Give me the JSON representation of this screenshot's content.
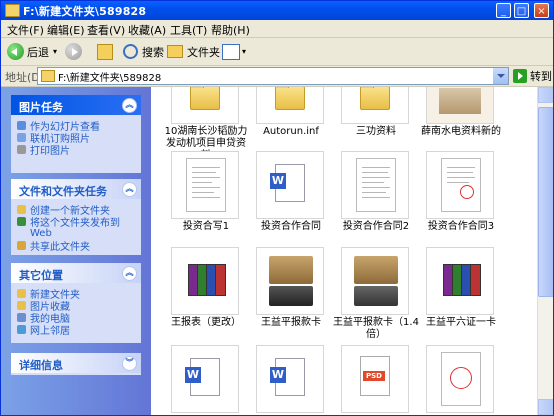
{
  "window": {
    "title": "F:\\新建文件夹\\589828",
    "buttons": {
      "minimize": "_",
      "maximize": "□",
      "close": "×"
    }
  },
  "menu": [
    "文件(F)",
    "编辑(E)",
    "查看(V)",
    "收藏(A)",
    "工具(T)",
    "帮助(H)"
  ],
  "toolbar": {
    "back": "后退",
    "search": "搜索",
    "folders": "文件夹"
  },
  "address": {
    "label": "地址(D)",
    "value": "F:\\新建文件夹\\589828",
    "go": "转到"
  },
  "tasks": {
    "picture_tasks": {
      "title": "图片任务",
      "items": [
        "作为幻灯片查看",
        "联机订购照片",
        "打印图片"
      ]
    },
    "file_tasks": {
      "title": "文件和文件夹任务",
      "items": [
        "创建一个新文件夹",
        "将这个文件夹发布到",
        "Web",
        "共享此文件夹"
      ]
    },
    "other_places": {
      "title": "其它位置",
      "items": [
        "新建文件夹",
        "图片收藏",
        "我的电脑",
        "网上邻居"
      ]
    },
    "details": {
      "title": "详细信息"
    }
  },
  "files": [
    {
      "name": "10湖南长沙韬励力发动机项目申贷资料",
      "type": "folder"
    },
    {
      "name": "Autorun.inf",
      "type": "folder"
    },
    {
      "name": "三功资料",
      "type": "folder"
    },
    {
      "name": "薛南水电资料新的",
      "type": "photo"
    },
    {
      "name": "投资合写1",
      "type": "document"
    },
    {
      "name": "投资合作合同",
      "type": "word"
    },
    {
      "name": "投资合作合同2",
      "type": "document"
    },
    {
      "name": "投资合作合同3",
      "type": "document-stamp"
    },
    {
      "name": "王报表（更改）",
      "type": "archive"
    },
    {
      "name": "王益平报款卡",
      "type": "card"
    },
    {
      "name": "王益平报款卡（1.4倍）",
      "type": "card"
    },
    {
      "name": "王益平六证一卡",
      "type": "archive"
    },
    {
      "name": "",
      "type": "word"
    },
    {
      "name": "",
      "type": "word"
    },
    {
      "name": "",
      "type": "psd"
    },
    {
      "name": "",
      "type": "stamp"
    }
  ],
  "colors": {
    "title_bar": "#0050ee",
    "task_pane": "#6f8edd",
    "link": "#215dc6"
  }
}
